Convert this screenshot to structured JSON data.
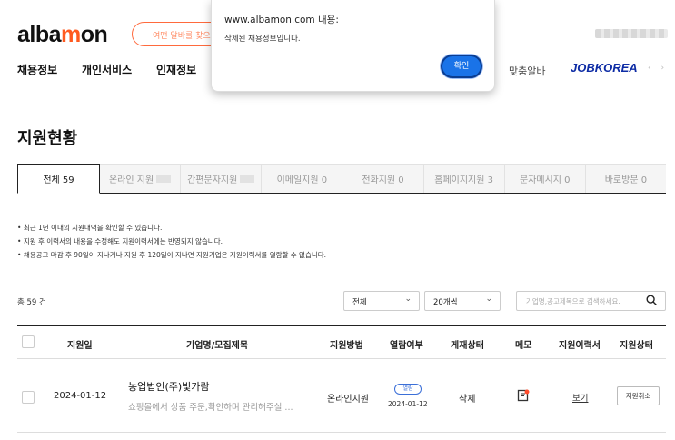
{
  "header": {
    "logo_text": "albamon",
    "search_placeholder": "여떤 알바를 찾으",
    "nav": [
      "채용정보",
      "개인서비스",
      "인재정보"
    ],
    "right_link": "맞춤알바",
    "partner_logo": "JOBKOREA",
    "carousel_arrows": "‹ ›"
  },
  "dialog": {
    "title": "www.albamon.com 내용:",
    "message": "삭제된 채용정보입니다.",
    "ok_label": "확인"
  },
  "page_title": "지원현황",
  "tabs": [
    {
      "label": "전체 59",
      "active": true
    },
    {
      "label": "온라인 지원",
      "redacted": true
    },
    {
      "label": "간편문자지원",
      "redacted": true
    },
    {
      "label": "이메일지원 0"
    },
    {
      "label": "전화지원 0"
    },
    {
      "label": "홈페이지지원 3"
    },
    {
      "label": "문자메시지 0"
    },
    {
      "label": "바로방문 0"
    }
  ],
  "notices": [
    "최근 1년 이내의 지원내역을 확인할 수 있습니다.",
    "지원 후 이력서의 내용을 수정해도 지원이력서에는 반영되지 않습니다.",
    "채용공고 마감 후 90일이 지나거나 지원 후 120일이 지나면 지원기업은 지원이력서를 열람할 수 없습니다."
  ],
  "toolbar": {
    "total": "총 59 건",
    "filter_selected": "전체",
    "page_size_selected": "20개씩",
    "search_placeholder": "기업명,공고제목으로 검색하세요."
  },
  "table": {
    "headers": [
      "지원일",
      "기업명/모집제목",
      "지원방법",
      "열람여부",
      "게재상태",
      "메모",
      "지원이력서",
      "지원상태"
    ],
    "rows": [
      {
        "date": "2024-01-12",
        "company": "농업법인(주)빛가람",
        "job_title": "쇼핑몰에서 상품 주문,확인하며 관리해주실 ...",
        "method": "온라인지원",
        "read_badge": "열람",
        "read_date": "2024-01-12",
        "posting_status": "삭제",
        "resume_link": "보기",
        "action_label": "지원취소"
      }
    ]
  },
  "colors": {
    "brand": "#ff5a1f",
    "link_blue": "#3b6fd8",
    "dialog_button": "#1a73e8",
    "jobkorea": "#0e2ca5"
  }
}
